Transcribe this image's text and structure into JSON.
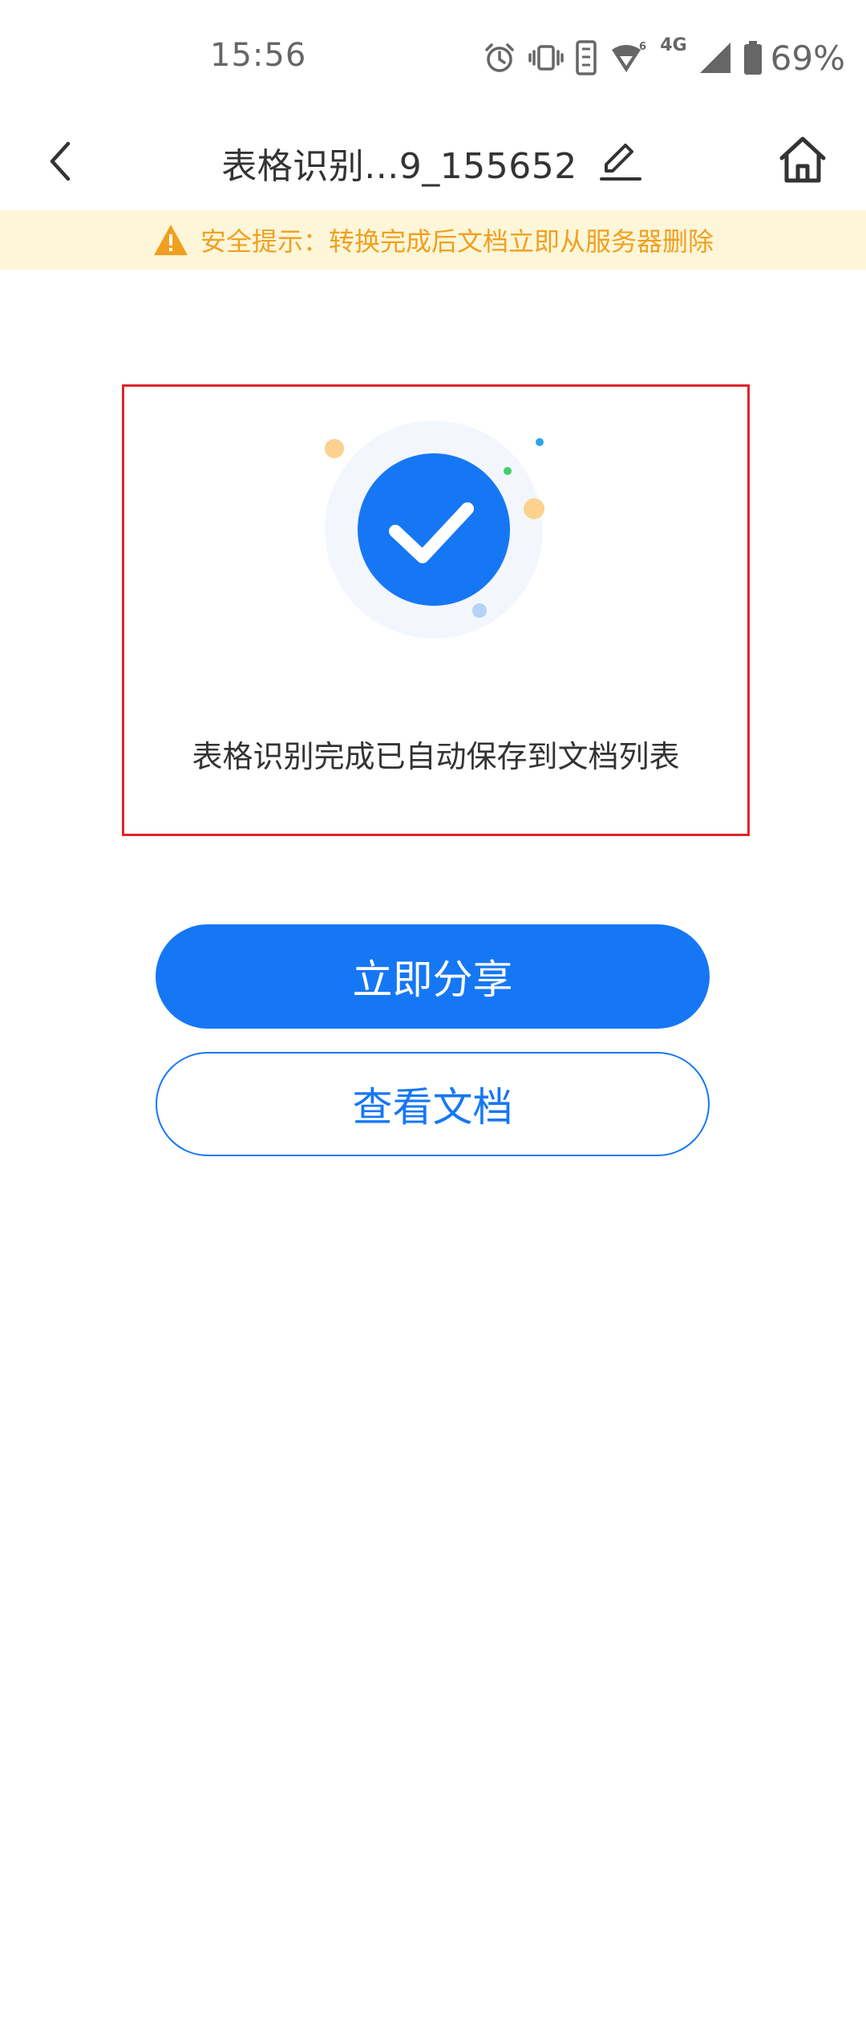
{
  "status_bar": {
    "time": "15:56",
    "network": "4G",
    "battery": "69%",
    "icons": [
      "alarm-icon",
      "vibrate-icon",
      "data-saver-icon",
      "wifi-icon",
      "signal-icon",
      "battery-icon"
    ]
  },
  "header": {
    "title": "表格识别...9_155652",
    "icons": [
      "back-arrow-icon",
      "edit-pencil-icon",
      "home-icon"
    ]
  },
  "notice": {
    "text": "安全提示：转换完成后文档立即从服务器删除",
    "icon": "warning-triangle-icon",
    "color": "#f0a020",
    "background": "#fdf6d8"
  },
  "result": {
    "icon": "check-circle-icon",
    "message": "表格识别完成已自动保存到文档列表"
  },
  "actions": {
    "share_label": "立即分享",
    "view_label": "查看文档"
  },
  "colors": {
    "accent": "#1677f5",
    "highlight_border": "#e0242a"
  }
}
